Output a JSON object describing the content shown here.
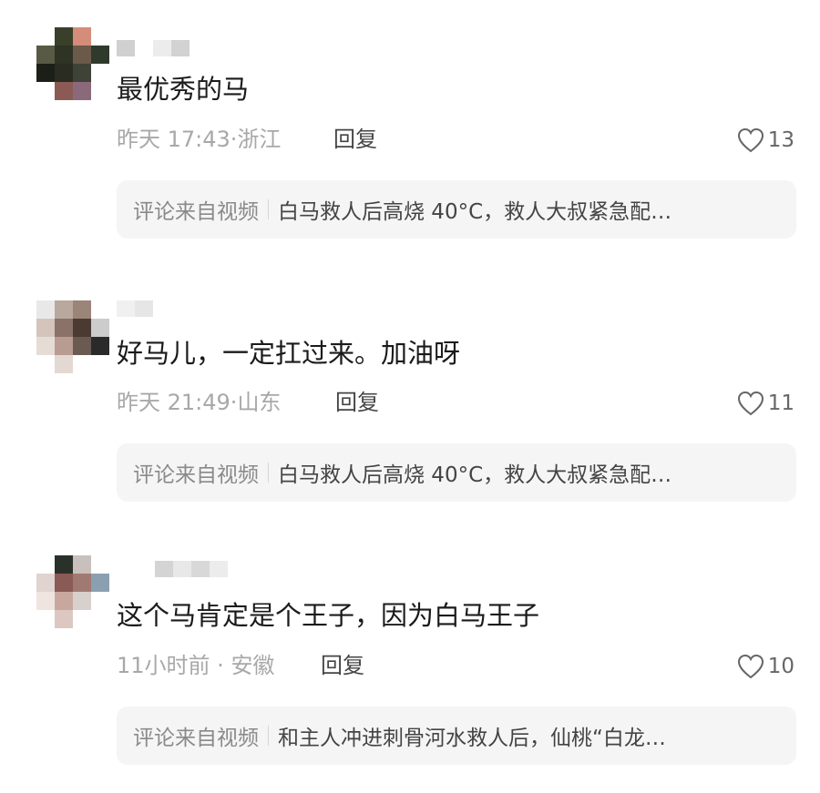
{
  "comments": [
    {
      "text": "最优秀的马",
      "time": "昨天 17:43",
      "location": "浙江",
      "reply_label": "回复",
      "likes": "13",
      "source_label": "评论来自视频",
      "source_title": "白马救人后高烧 40°C，救人大叔紧急配…",
      "avatar_colors": [
        "#ffffff",
        "#3a3f2a",
        "#d58c78",
        "#ffffff",
        "#595a45",
        "#2e3324",
        "#6b5a4a",
        "#2f3a2c",
        "#1c1f18",
        "#2a2c22",
        "#3e4237",
        "#ffffff",
        "#ffffff",
        "#8b5a55",
        "#8a6a7a",
        "#ffffff"
      ],
      "username_colors": [
        "#d0d0d0",
        "#ffffff",
        "#ececec",
        "#d2d2d2"
      ]
    },
    {
      "text": "好马儿，一定扛过来。加油呀",
      "time": "昨天 21:49",
      "location": "山东",
      "reply_label": "回复",
      "likes": "11",
      "source_label": "评论来自视频",
      "source_title": "白马救人后高烧 40°C，救人大叔紧急配…",
      "avatar_colors": [
        "#e8e8e8",
        "#b8a89e",
        "#9b8478",
        "#ffffff",
        "#d4c4bc",
        "#8a7268",
        "#4a3a32",
        "#cccccc",
        "#e6dcd6",
        "#b89c92",
        "#6a5a52",
        "#2a2a2a",
        "#ffffff",
        "#e4d8d2",
        "#ffffff",
        "#ffffff"
      ],
      "username_colors": [
        "#f0f0f0",
        "#e6e6e6",
        "#ffffff",
        "#ffffff"
      ]
    },
    {
      "text": "这个马肯定是个王子，因为白马王子",
      "time": "11小时前",
      "location": "安徽",
      "reply_label": "回复",
      "likes": "10",
      "source_label": "评论来自视频",
      "source_title": "和主人冲进刺骨河水救人后，仙桃“白龙…",
      "avatar_colors": [
        "#ffffff",
        "#2a302a",
        "#c8c0bc",
        "#ffffff",
        "#e0d4d0",
        "#8a5a55",
        "#a07a72",
        "#8aa0b0",
        "#f0e4e0",
        "#c8a89e",
        "#d8d0cc",
        "#ffffff",
        "#ffffff",
        "#dcc8c0",
        "#ffffff",
        "#ffffff"
      ],
      "username_colors": [
        "#d4d4d4",
        "#e8e8e8",
        "#d8d8d8",
        "#ececec"
      ]
    }
  ]
}
